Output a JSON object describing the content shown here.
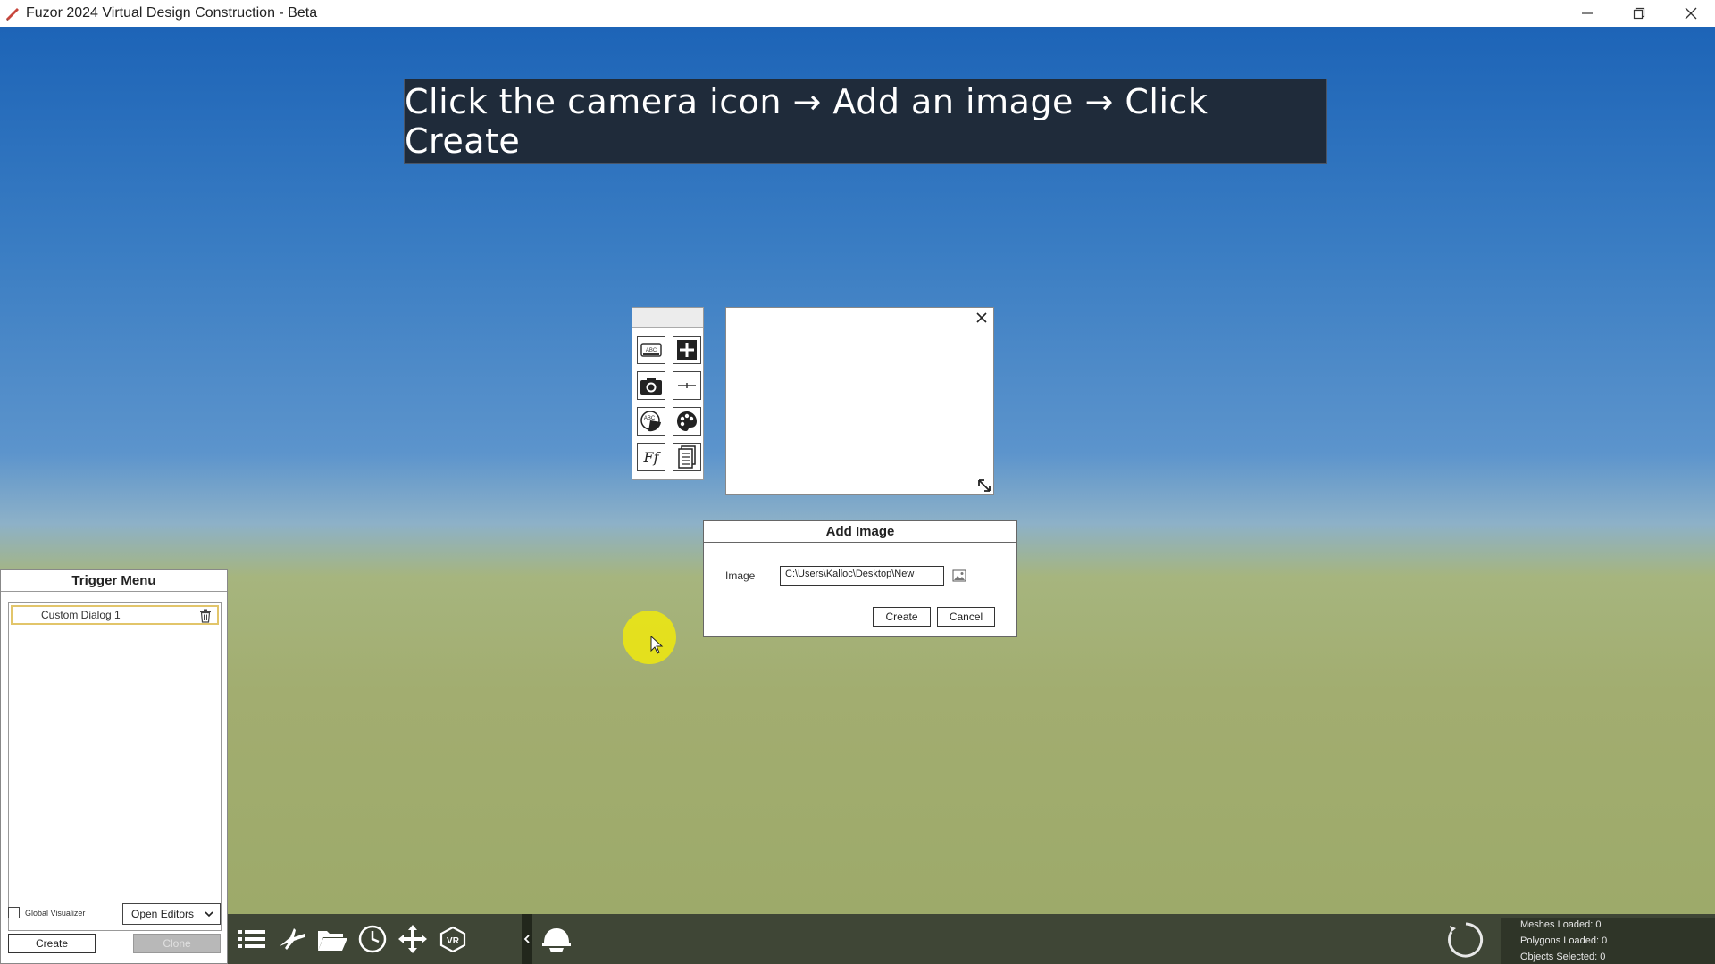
{
  "window": {
    "title": "Fuzor 2024 Virtual Design Construction - Beta"
  },
  "banner": {
    "text": "Click the camera icon → Add an image → Click Create"
  },
  "tools": [
    {
      "icon": "text-label-icon"
    },
    {
      "icon": "add-plus-icon"
    },
    {
      "icon": "camera-icon"
    },
    {
      "icon": "line-divider-icon"
    },
    {
      "icon": "text-fill-icon"
    },
    {
      "icon": "palette-icon"
    },
    {
      "icon": "font-icon",
      "label": "Ff"
    },
    {
      "icon": "document-list-icon"
    }
  ],
  "add_image_dialog": {
    "title": "Add Image",
    "image_label": "Image",
    "image_path": "C:\\Users\\Kalloc\\Desktop\\New",
    "create_label": "Create",
    "cancel_label": "Cancel"
  },
  "trigger_menu": {
    "title": "Trigger Menu",
    "items": [
      {
        "label": "Custom Dialog 1"
      }
    ],
    "global_visualizer_label": "Global Visualizer",
    "open_editors_label": "Open Editors",
    "create_label": "Create",
    "clone_label": "Clone"
  },
  "stats": {
    "meshes": "Meshes Loaded: 0",
    "polygons": "Polygons Loaded: 0",
    "objects": "Objects Selected: 0"
  },
  "colors": {
    "banner_bg": "#1f2b3a",
    "toolbar_bg": "#3f4636",
    "cursor_highlight": "#ebe614",
    "selected_item_border": "#e2c56a"
  }
}
